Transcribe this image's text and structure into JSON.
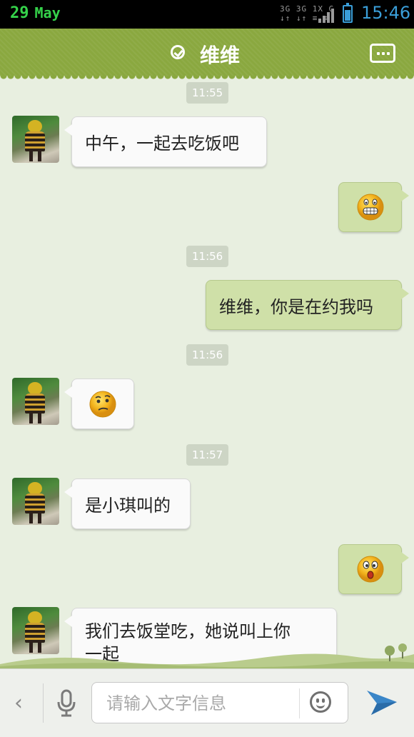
{
  "status_bar": {
    "day": "29",
    "month": "May",
    "net_line1": "3G 3G 1X G",
    "time": "15:46",
    "accent": "#3a9ed8"
  },
  "header": {
    "title": "维维",
    "bg_color": "#8aa83f"
  },
  "messages": [
    {
      "type": "timestamp",
      "text": "11:55"
    },
    {
      "type": "incoming",
      "text": "中午，一起去吃饭吧"
    },
    {
      "type": "outgoing",
      "emoji": "grin-emoji"
    },
    {
      "type": "timestamp",
      "text": "11:56"
    },
    {
      "type": "outgoing",
      "text": "维维，你是在约我吗"
    },
    {
      "type": "timestamp",
      "text": "11:56"
    },
    {
      "type": "incoming",
      "emoji": "confused-emoji"
    },
    {
      "type": "timestamp",
      "text": "11:57"
    },
    {
      "type": "incoming",
      "text": "是小琪叫的"
    },
    {
      "type": "outgoing",
      "emoji": "surprised-emoji"
    },
    {
      "type": "incoming",
      "text_line1": "我们去饭堂吃，她说叫上你",
      "text_line2": "一起"
    }
  ],
  "input_bar": {
    "back_glyph": "‹",
    "placeholder": "请输入文字信息",
    "icons": [
      "back-icon",
      "microphone-icon",
      "emoji-icon",
      "send-icon"
    ]
  }
}
